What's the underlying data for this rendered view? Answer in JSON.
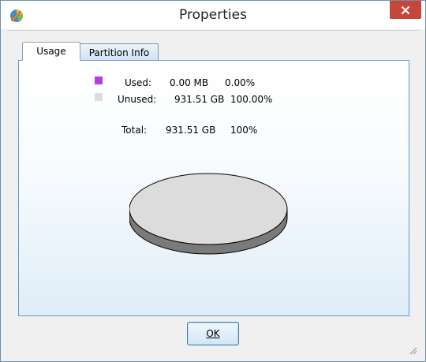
{
  "window": {
    "title": "Properties",
    "app_icon": "partition-tool-icon",
    "close_icon": "close-icon"
  },
  "tabs": [
    {
      "label": "Usage",
      "selected": true
    },
    {
      "label": "Partition Info",
      "selected": false
    }
  ],
  "usage": {
    "used": {
      "label": "Used:",
      "size": "0.00 MB",
      "percent": "0.00%",
      "color": "#b040d8"
    },
    "unused": {
      "label": "Unused:",
      "size": "931.51 GB",
      "percent": "100.00%",
      "color": "#dcdcdc"
    },
    "total": {
      "label": "Total:",
      "size": "931.51 GB",
      "percent": "100%"
    }
  },
  "chart_data": {
    "type": "pie",
    "categories": [
      "Used",
      "Unused"
    ],
    "values": [
      0.0,
      100.0
    ],
    "colors": [
      "#b040d8",
      "#dcdcdc"
    ],
    "style": "3d"
  },
  "buttons": {
    "ok_label": "OK"
  }
}
